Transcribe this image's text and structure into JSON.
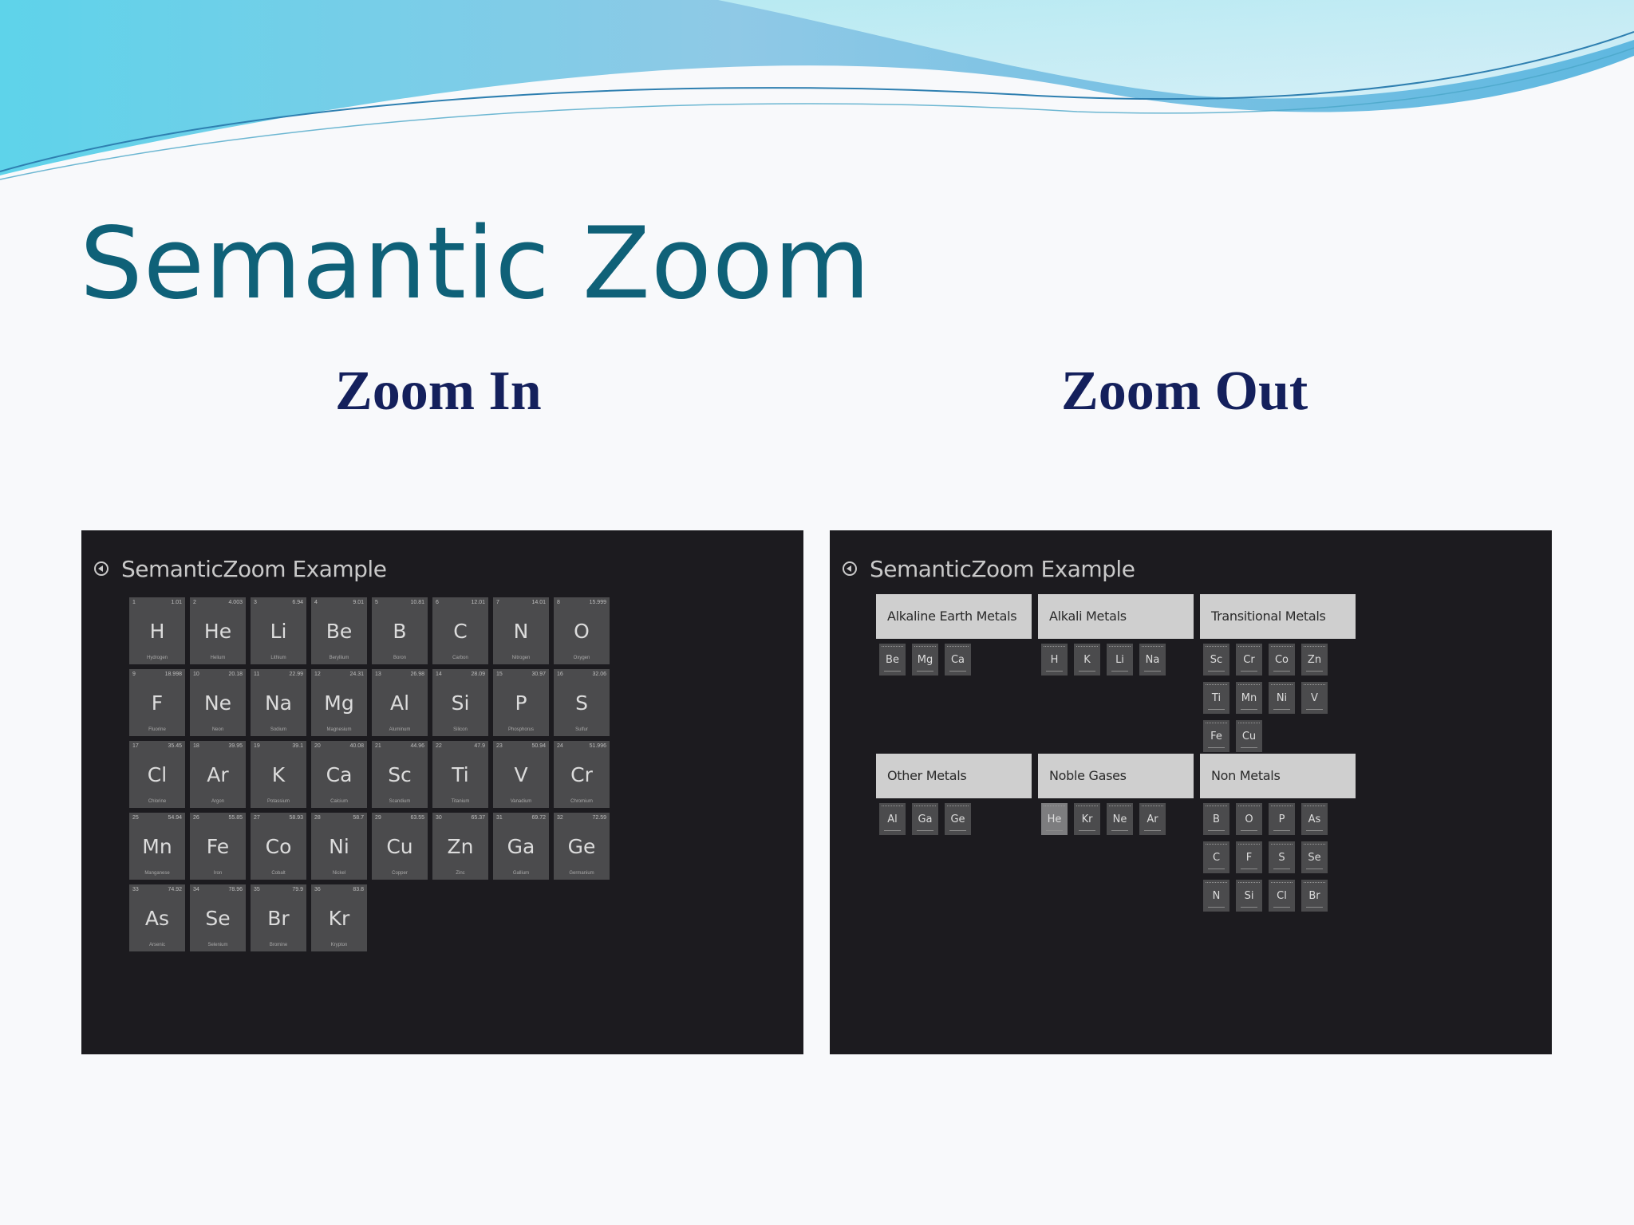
{
  "slide": {
    "title": "Semantic Zoom",
    "zoom_in_label": "Zoom In",
    "zoom_out_label": "Zoom Out"
  },
  "zoom_in": {
    "app_title": "SemanticZoom Example",
    "elements": [
      {
        "symbol": "H",
        "number": "1",
        "mass": "1.01",
        "name": "Hydrogen"
      },
      {
        "symbol": "He",
        "number": "2",
        "mass": "4.003",
        "name": "Helium"
      },
      {
        "symbol": "Li",
        "number": "3",
        "mass": "6.94",
        "name": "Lithium"
      },
      {
        "symbol": "Be",
        "number": "4",
        "mass": "9.01",
        "name": "Beryllium"
      },
      {
        "symbol": "B",
        "number": "5",
        "mass": "10.81",
        "name": "Boron"
      },
      {
        "symbol": "C",
        "number": "6",
        "mass": "12.01",
        "name": "Carbon"
      },
      {
        "symbol": "N",
        "number": "7",
        "mass": "14.01",
        "name": "Nitrogen"
      },
      {
        "symbol": "O",
        "number": "8",
        "mass": "15.999",
        "name": "Oxygen"
      },
      {
        "symbol": "F",
        "number": "9",
        "mass": "18.998",
        "name": "Fluorine"
      },
      {
        "symbol": "Ne",
        "number": "10",
        "mass": "20.18",
        "name": "Neon"
      },
      {
        "symbol": "Na",
        "number": "11",
        "mass": "22.99",
        "name": "Sodium"
      },
      {
        "symbol": "Mg",
        "number": "12",
        "mass": "24.31",
        "name": "Magnesium"
      },
      {
        "symbol": "Al",
        "number": "13",
        "mass": "26.98",
        "name": "Aluminum"
      },
      {
        "symbol": "Si",
        "number": "14",
        "mass": "28.09",
        "name": "Silicon"
      },
      {
        "symbol": "P",
        "number": "15",
        "mass": "30.97",
        "name": "Phosphorus"
      },
      {
        "symbol": "S",
        "number": "16",
        "mass": "32.06",
        "name": "Sulfur"
      },
      {
        "symbol": "Cl",
        "number": "17",
        "mass": "35.45",
        "name": "Chlorine"
      },
      {
        "symbol": "Ar",
        "number": "18",
        "mass": "39.95",
        "name": "Argon"
      },
      {
        "symbol": "K",
        "number": "19",
        "mass": "39.1",
        "name": "Potassium"
      },
      {
        "symbol": "Ca",
        "number": "20",
        "mass": "40.08",
        "name": "Calcium"
      },
      {
        "symbol": "Sc",
        "number": "21",
        "mass": "44.96",
        "name": "Scandium"
      },
      {
        "symbol": "Ti",
        "number": "22",
        "mass": "47.9",
        "name": "Titanium"
      },
      {
        "symbol": "V",
        "number": "23",
        "mass": "50.94",
        "name": "Vanadium"
      },
      {
        "symbol": "Cr",
        "number": "24",
        "mass": "51.996",
        "name": "Chromium"
      },
      {
        "symbol": "Mn",
        "number": "25",
        "mass": "54.94",
        "name": "Manganese"
      },
      {
        "symbol": "Fe",
        "number": "26",
        "mass": "55.85",
        "name": "Iron"
      },
      {
        "symbol": "Co",
        "number": "27",
        "mass": "58.93",
        "name": "Cobalt"
      },
      {
        "symbol": "Ni",
        "number": "28",
        "mass": "58.7",
        "name": "Nickel"
      },
      {
        "symbol": "Cu",
        "number": "29",
        "mass": "63.55",
        "name": "Copper"
      },
      {
        "symbol": "Zn",
        "number": "30",
        "mass": "65.37",
        "name": "Zinc"
      },
      {
        "symbol": "Ga",
        "number": "31",
        "mass": "69.72",
        "name": "Gallium"
      },
      {
        "symbol": "Ge",
        "number": "32",
        "mass": "72.59",
        "name": "Germanium"
      },
      {
        "symbol": "As",
        "number": "33",
        "mass": "74.92",
        "name": "Arsenic"
      },
      {
        "symbol": "Se",
        "number": "34",
        "mass": "78.96",
        "name": "Selenium"
      },
      {
        "symbol": "Br",
        "number": "35",
        "mass": "79.9",
        "name": "Bromine"
      },
      {
        "symbol": "Kr",
        "number": "36",
        "mass": "83.8",
        "name": "Krypton"
      }
    ]
  },
  "zoom_out": {
    "app_title": "SemanticZoom Example",
    "groups": [
      {
        "name": "Alkaline Earth Metals",
        "elements": [
          "Be",
          "Mg",
          "Ca"
        ]
      },
      {
        "name": "Alkali Metals",
        "elements": [
          "H",
          "K",
          "Li",
          "Na"
        ]
      },
      {
        "name": "Transitional Metals",
        "elements": [
          "Sc",
          "Cr",
          "Co",
          "Zn",
          "Ti",
          "Mn",
          "Ni",
          "V",
          "Fe",
          "Cu"
        ]
      },
      {
        "name": "Other Metals",
        "elements": [
          "Al",
          "Ga",
          "Ge"
        ]
      },
      {
        "name": "Noble Gases",
        "elements": [
          "He",
          "Kr",
          "Ne",
          "Ar"
        ],
        "highlighted": "He"
      },
      {
        "name": "Non Metals",
        "elements": [
          "B",
          "O",
          "P",
          "As",
          "C",
          "F",
          "S",
          "Se",
          "N",
          "Si",
          "Cl",
          "Br"
        ]
      }
    ]
  },
  "colors": {
    "title": "#0f6178",
    "subtitle": "#14205c",
    "screen_bg": "#1c1b1f",
    "tile": "#4b4b4d",
    "group_header": "#cfcfcf"
  }
}
